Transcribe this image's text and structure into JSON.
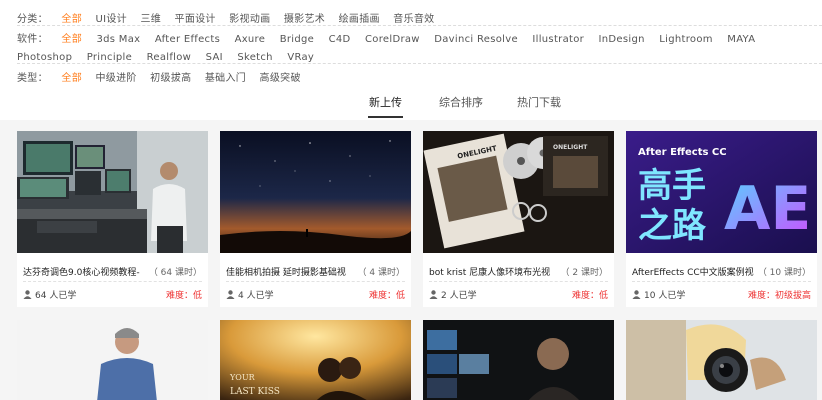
{
  "filters": {
    "category": {
      "label": "分类：",
      "options": [
        "全部",
        "UI设计",
        "三维",
        "平面设计",
        "影视动画",
        "摄影艺术",
        "绘画插画",
        "音乐音效"
      ]
    },
    "software": {
      "label": "软件：",
      "options": [
        "全部",
        "3ds Max",
        "After Effects",
        "Axure",
        "Bridge",
        "C4D",
        "CorelDraw",
        "Davinci Resolve",
        "Illustrator",
        "InDesign",
        "Lightroom",
        "MAYA",
        "Photoshop",
        "Principle",
        "Realflow",
        "SAI",
        "Sketch",
        "VRay"
      ]
    },
    "type": {
      "label": "类型：",
      "options": [
        "全部",
        "中级进阶",
        "初级拔高",
        "基础入门",
        "高级突破"
      ]
    }
  },
  "tabs": [
    "新上传",
    "综合排序",
    "热门下载"
  ],
  "cards": [
    {
      "title": "达芬奇调色9.0核心视频教程-",
      "hours": "（ 64 课时）",
      "users": "64 人已学",
      "level": "难度：低"
    },
    {
      "title": "佳能相机拍摄 延时摄影基础视",
      "hours": "（ 4 课时）",
      "users": "4 人已学",
      "level": "难度：低"
    },
    {
      "title": "bot krist 尼康人像环境布光视",
      "hours": "（ 2 课时）",
      "users": "2 人已学",
      "level": "难度：低"
    },
    {
      "title": "AfterEffects CC中文版案例视",
      "hours": "（ 10 课时）",
      "users": "10 人已学",
      "level": "难度：初级拔高"
    }
  ],
  "thumb_text": {
    "onelight_1": "ONELIGHT",
    "onelight_2": "ONELIGHT",
    "ae_title": "After Effects CC",
    "ae_big_1": "高手",
    "ae_big_2": "之路",
    "ae_logo": "AE",
    "lastkiss_1": "YOUR",
    "lastkiss_2": "LAST KISS"
  },
  "colors": {
    "accent": "#ff7e1d",
    "level": "#e33333",
    "ae_bg": "#2a1a6e"
  },
  "icons": {
    "users": "user-icon"
  }
}
